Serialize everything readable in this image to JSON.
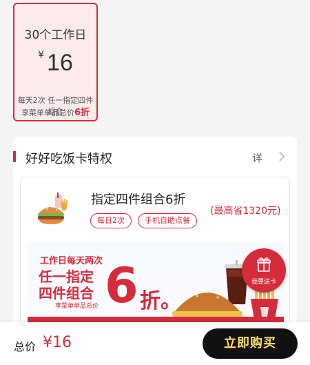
{
  "plan": {
    "title": "30个工作日",
    "currency": "¥",
    "price": "16",
    "desc_line1": "每天2次 任一指定四件组合",
    "desc_line2_prefix": "享菜单单品总价",
    "desc_line2_highlight": "6折"
  },
  "privilege": {
    "title": "好好吃饭卡特权",
    "detail_label": "详"
  },
  "offer": {
    "title": "指定四件组合6折",
    "save_text": "(最高省1320元)",
    "tags": [
      "每日2次",
      "手机自助点餐"
    ],
    "banner": {
      "line1": "工作日每天两次",
      "line2": "任一指定",
      "line3": "四件组合",
      "line4": "享菜单单品总价",
      "big_number": "6",
      "suffix": "折。"
    }
  },
  "gift_button": {
    "label": "我要送卡"
  },
  "bottom_bar": {
    "total_label": "总价",
    "total_value": "¥16",
    "buy_label": "立即购买"
  },
  "colors": {
    "accent": "#d52c3c",
    "buy_button_bg": "#111111",
    "buy_button_text": "#fcdc68"
  }
}
